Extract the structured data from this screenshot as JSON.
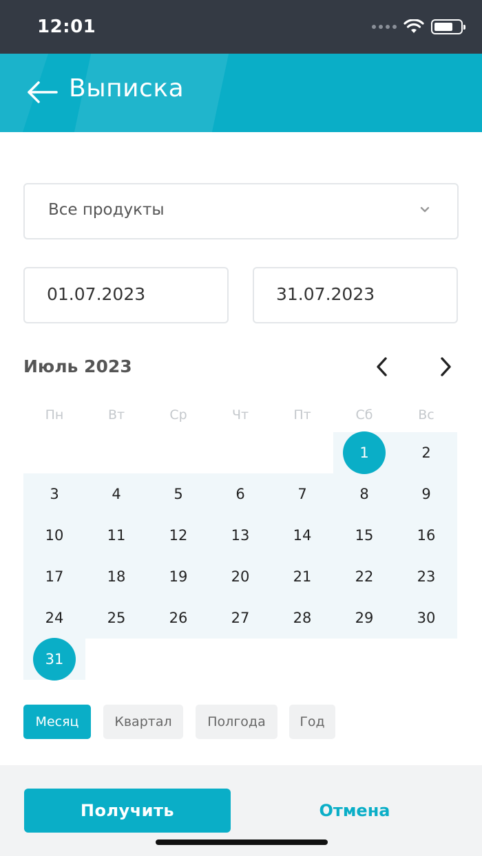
{
  "status_bar": {
    "time": "12:01"
  },
  "header": {
    "title": "Выписка"
  },
  "product_select": {
    "value": "Все продукты"
  },
  "date_range": {
    "from": "01.07.2023",
    "to": "31.07.2023"
  },
  "calendar": {
    "month_title": "Июль 2023",
    "weekdays": [
      "Пн",
      "Вт",
      "Ср",
      "Чт",
      "Пт",
      "Сб",
      "Вс"
    ],
    "days": [
      "1",
      "2",
      "3",
      "4",
      "5",
      "6",
      "7",
      "8",
      "9",
      "10",
      "11",
      "12",
      "13",
      "14",
      "15",
      "16",
      "17",
      "18",
      "19",
      "20",
      "21",
      "22",
      "23",
      "24",
      "25",
      "26",
      "27",
      "28",
      "29",
      "30",
      "31"
    ],
    "first_weekday_index": 5,
    "selected_start": "1",
    "selected_end": "31"
  },
  "period_chips": [
    "Месяц",
    "Квартал",
    "Полгода",
    "Год"
  ],
  "active_chip": "Месяц",
  "footer": {
    "submit_label": "Получить",
    "cancel_label": "Отмена"
  },
  "colors": {
    "accent": "#0aaec7",
    "status_bar": "#343a44",
    "range_band": "#f0f7fa"
  }
}
